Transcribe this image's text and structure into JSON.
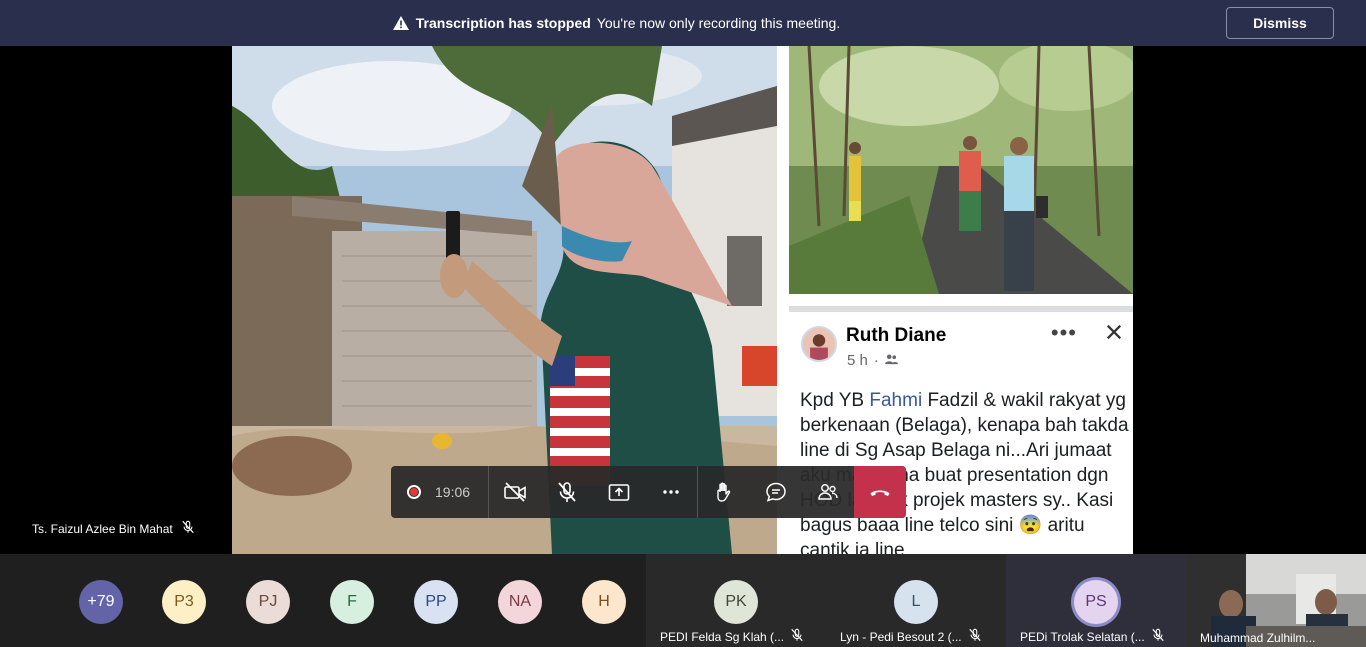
{
  "banner": {
    "title": "Transcription has stopped",
    "message": "You're now only recording this meeting.",
    "dismiss_label": "Dismiss"
  },
  "post": {
    "author": "Ruth Diane",
    "time": "5 h",
    "text_before_link": "Kpd YB ",
    "link_text": "Fahmi",
    "text_after_link": " Fadzil & wakil rakyat yg berkenaan (Belaga), kenapa bah takda line di Sg Asap Belaga ni...Ari jumaat aku mau kena buat presentation dgn HOD lagi utk projek masters sy.. Kasi bagus baaa line telco sini 😨 aritu cantik ja line"
  },
  "controls": {
    "timer": "19:06"
  },
  "presenter": {
    "name": "Ts. Faizul Azlee Bin Mahat"
  },
  "participants": {
    "overflow": "+79",
    "avatars": [
      {
        "initials": "P3",
        "color": "#fdf0c6"
      },
      {
        "initials": "PJ",
        "color": "#ecdcd7"
      },
      {
        "initials": "F",
        "color": "#d7efdf"
      },
      {
        "initials": "PP",
        "color": "#d8e2f3"
      },
      {
        "initials": "NA",
        "color": "#f2d6d9"
      },
      {
        "initials": "H",
        "color": "#fde7cc"
      }
    ],
    "tiles": [
      {
        "initials": "PK",
        "name": "PEDI Felda Sg Klah (...",
        "color": "#dfe6d8"
      },
      {
        "initials": "L",
        "name": "Lyn - Pedi Besout 2 (...",
        "color": "#d6e3ee"
      },
      {
        "initials": "PS",
        "name": "PEDi Trolak Selatan (...",
        "color": "#e4d4ef"
      }
    ],
    "camera_tile_name": "Muhammad Zulhilm..."
  },
  "colors": {
    "banner_bg": "#2b2f4e",
    "hangup": "#c4314b",
    "overflow_avatar": "#6264a7",
    "speaking_ring": "#8b8cc7"
  }
}
